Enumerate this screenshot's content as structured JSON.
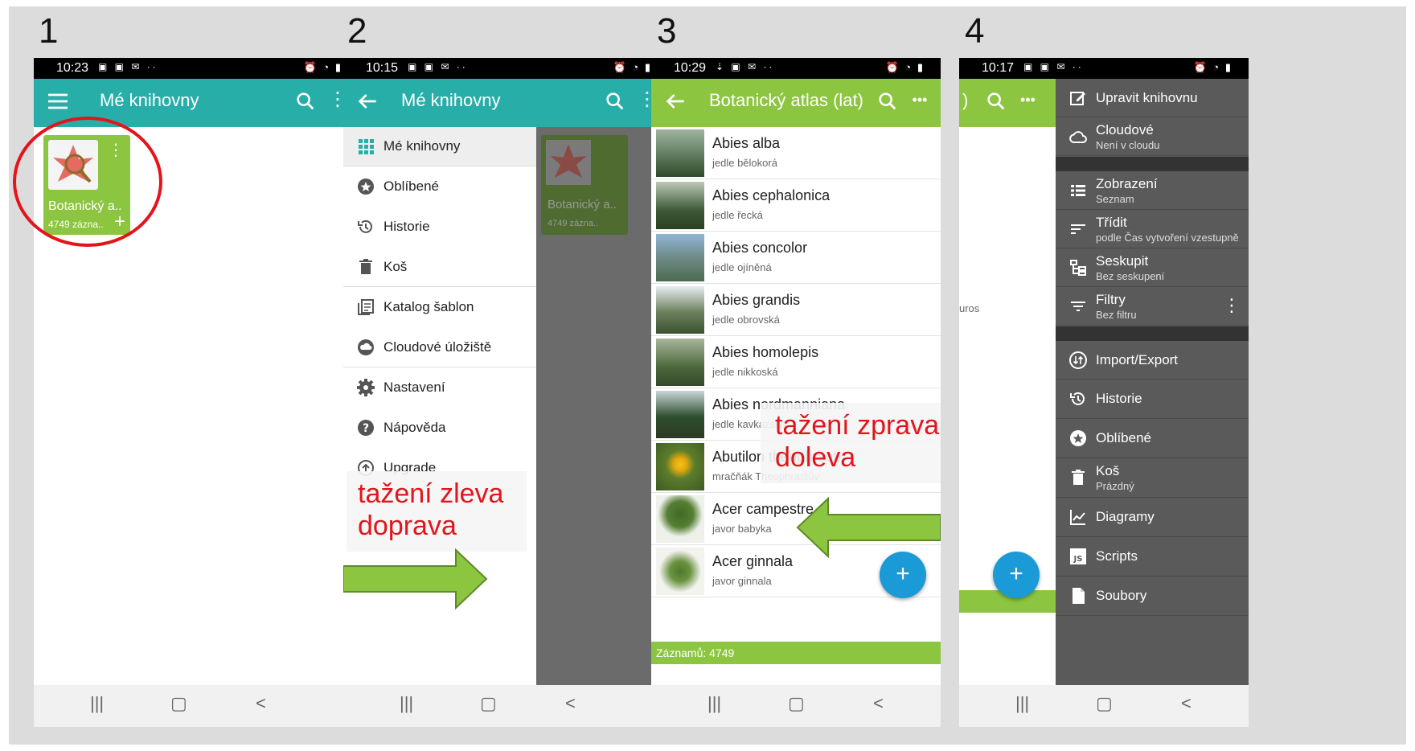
{
  "panels": [
    {
      "number": "1"
    },
    {
      "number": "2"
    },
    {
      "number": "3"
    },
    {
      "number": "4"
    }
  ],
  "colors": {
    "teal": "#27aea9",
    "green": "#8cc540",
    "red": "#e3141c",
    "fab": "#1a9ad6"
  },
  "status_times": [
    "10:23",
    "10:15",
    "10:29",
    "10:17"
  ],
  "screen1": {
    "title": "Mé knihovny",
    "card_name": "Botanický a..",
    "card_count": "4749 zázna.."
  },
  "screen2": {
    "title": "Mé knihovny",
    "drawer_items": [
      {
        "label": "Mé knihovny",
        "icon": "grid-icon"
      },
      {
        "label": "Oblíbené",
        "icon": "star-icon"
      },
      {
        "label": "Historie",
        "icon": "history-icon"
      },
      {
        "label": "Koš",
        "icon": "trash-icon"
      },
      {
        "label": "Katalog šablon",
        "icon": "catalog-icon"
      },
      {
        "label": "Cloudové úložiště",
        "icon": "cloud-icon"
      },
      {
        "label": "Nastavení",
        "icon": "gear-icon"
      },
      {
        "label": "Nápověda",
        "icon": "help-icon"
      },
      {
        "label": "Upgrade",
        "icon": "upgrade-icon"
      }
    ],
    "bg_card_name": "Botanický a..",
    "bg_card_count": "4749 zázna..",
    "annotation_line1": "tažení zleva",
    "annotation_line2": "doprava"
  },
  "screen3": {
    "title": "Botanický atlas (lat)",
    "rows": [
      {
        "species": "Abies alba",
        "czech": "jedle bělokorá"
      },
      {
        "species": "Abies cephalonica",
        "czech": "jedle řecká"
      },
      {
        "species": "Abies concolor",
        "czech": "jedle ojíněná"
      },
      {
        "species": "Abies grandis",
        "czech": "jedle obrovská"
      },
      {
        "species": "Abies homolepis",
        "czech": "jedle nikkoská"
      },
      {
        "species": "Abies nordmanniana",
        "czech": "jedle kavkazská"
      },
      {
        "species": "Abutilon theophrasti",
        "czech": "mračňák Theophrastův"
      },
      {
        "species": "Acer campestre",
        "czech": "javor babyka"
      },
      {
        "species": "Acer ginnala",
        "czech": "javor ginnala"
      }
    ],
    "footer": "Záznamů: 4749",
    "fab": "+",
    "annotation_line1": "tažení zprava",
    "annotation_line2": "doleva"
  },
  "screen4": {
    "partial_title": ")",
    "partial_text": "uros",
    "fab": "+",
    "menu": [
      {
        "label": "Upravit knihovnu",
        "sub": "",
        "icon": "edit-icon"
      },
      {
        "label": "Cloudové",
        "sub": "Není v cloudu",
        "icon": "cloud-icon"
      },
      {
        "label": "Zobrazení",
        "sub": "Seznam",
        "icon": "list-view-icon"
      },
      {
        "label": "Třídit",
        "sub": "podle Čas vytvoření vzestupně",
        "icon": "sort-icon"
      },
      {
        "label": "Seskupit",
        "sub": "Bez seskupení",
        "icon": "group-icon"
      },
      {
        "label": "Filtry",
        "sub": "Bez filtru",
        "icon": "filter-icon"
      },
      {
        "label": "Import/Export",
        "sub": "",
        "icon": "import-export-icon"
      },
      {
        "label": "Historie",
        "sub": "",
        "icon": "history-icon"
      },
      {
        "label": "Oblíbené",
        "sub": "",
        "icon": "star-icon"
      },
      {
        "label": "Koš",
        "sub": "Prázdný",
        "icon": "trash-icon"
      },
      {
        "label": "Diagramy",
        "sub": "",
        "icon": "chart-icon"
      },
      {
        "label": "Scripts",
        "sub": "",
        "icon": "js-icon"
      },
      {
        "label": "Soubory",
        "sub": "",
        "icon": "file-icon"
      }
    ]
  }
}
